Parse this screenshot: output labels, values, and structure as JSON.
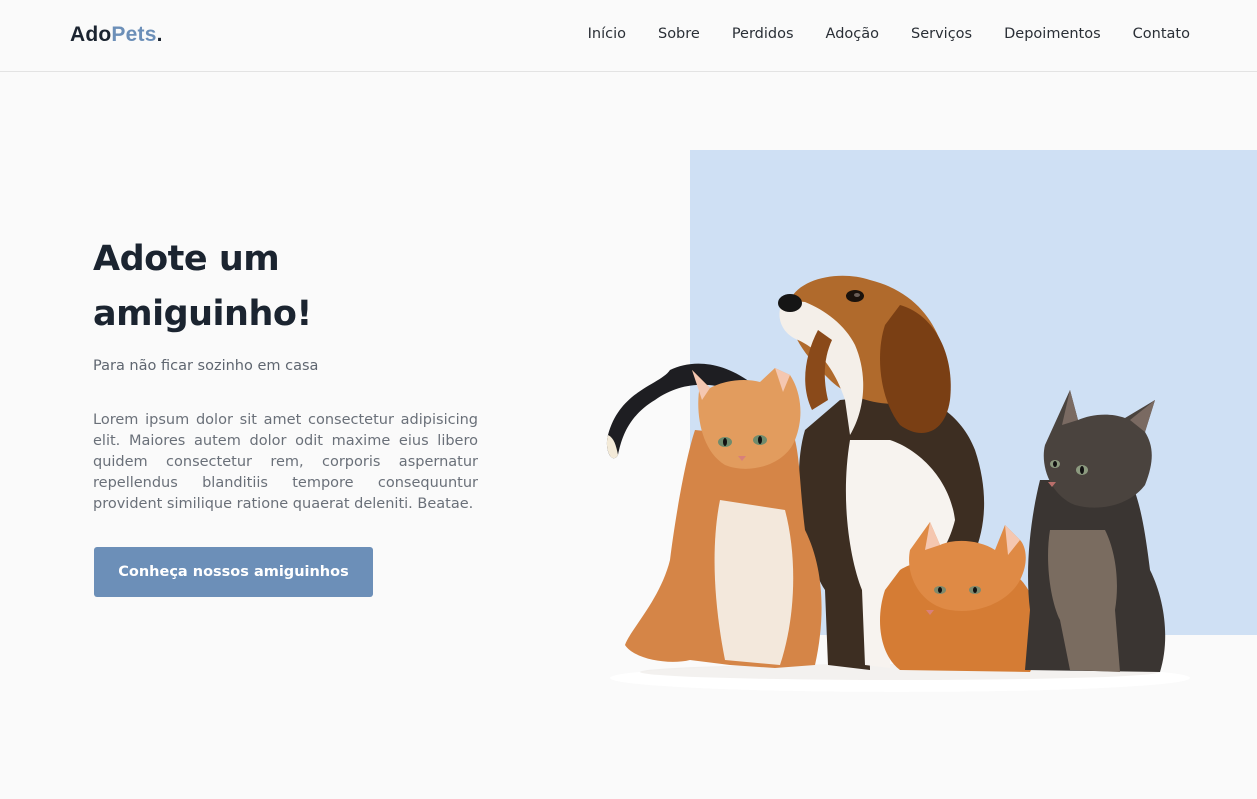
{
  "header": {
    "logo": {
      "part1": "Ado",
      "part2": "Pets",
      "dot": "."
    },
    "nav": [
      {
        "label": "Início"
      },
      {
        "label": "Sobre"
      },
      {
        "label": "Perdidos"
      },
      {
        "label": "Adoção"
      },
      {
        "label": "Serviços"
      },
      {
        "label": "Depoimentos"
      },
      {
        "label": "Contato"
      }
    ]
  },
  "hero": {
    "title": "Adote um amiguinho!",
    "subtitle": "Para não ficar sozinho em casa",
    "text": "Lorem ipsum dolor sit amet consectetur adipisicing elit. Maiores autem dolor odit maxime eius libero quidem consectetur rem, corporis aspernatur repellendus blanditiis tempore consequuntur provident similique ratione quaerat deleniti. Beatae.",
    "cta_label": "Conheça nossos amiguinhos",
    "image_alt": "beagle-and-kittens-photo"
  },
  "colors": {
    "accent": "#6c8fb8",
    "hero_panel": "#cfe0f4",
    "text_dark": "#1b2430",
    "background": "#fafafa"
  }
}
